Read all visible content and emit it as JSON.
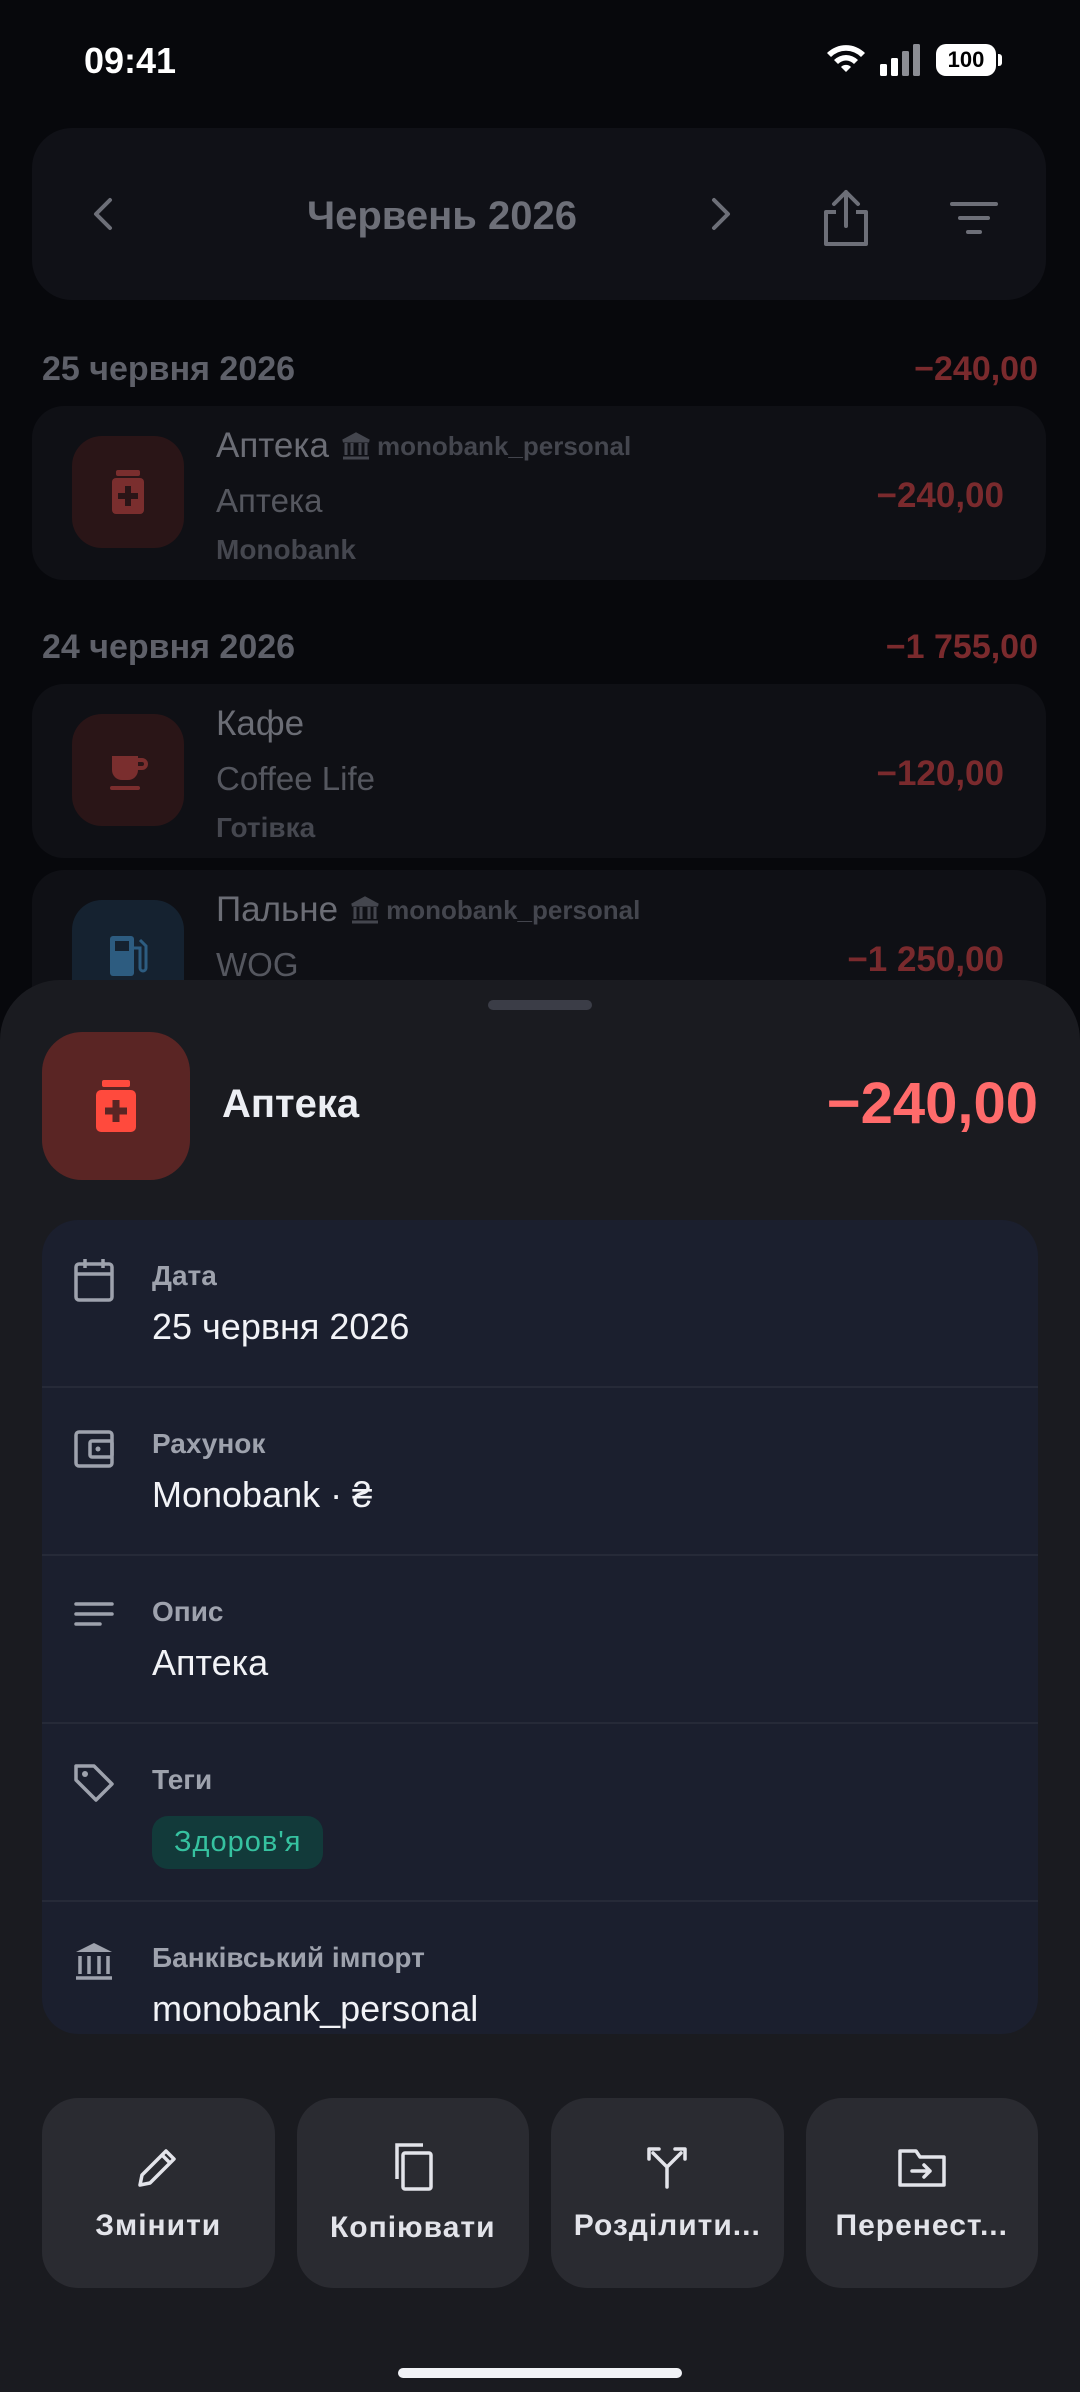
{
  "status": {
    "time": "09:41",
    "battery": "100"
  },
  "header": {
    "month": "Червень 2026"
  },
  "days": [
    {
      "date": "25 червня 2026",
      "total": "−240,00"
    },
    {
      "date": "24 червня 2026",
      "total": "−1 755,00"
    }
  ],
  "transactions": [
    {
      "category": "Аптека",
      "bank": "monobank_personal",
      "description": "Аптека",
      "account": "Monobank",
      "amount": "−240,00",
      "icon": "pharmacy-icon"
    },
    {
      "category": "Кафе",
      "bank": "",
      "description": "Coffee Life",
      "account": "Готівка",
      "amount": "−120,00",
      "icon": "coffee-icon"
    },
    {
      "category": "Пальне",
      "bank": "monobank_personal",
      "description": "WOG",
      "account": "",
      "amount": "−1 250,00",
      "icon": "fuel-icon"
    }
  ],
  "sheet": {
    "title": "Аптека",
    "amount": "−240,00",
    "fields": {
      "date": {
        "label": "Дата",
        "value": "25 червня 2026"
      },
      "account": {
        "label": "Рахунок",
        "value": "Monobank · ₴"
      },
      "description": {
        "label": "Опис",
        "value": "Аптека"
      },
      "tags": {
        "label": "Теги",
        "value": "Здоров'я"
      },
      "bank_import": {
        "label": "Банківський імпорт",
        "value": "monobank_personal"
      }
    },
    "actions": {
      "edit": "Змінити",
      "copy": "Копіювати",
      "split": "Розділити...",
      "move": "Перенест..."
    }
  },
  "colors": {
    "expense": "#ff6b6b",
    "tag_text": "#36c2a0",
    "tag_bg": "#123a3a",
    "card": "#1b1f2e",
    "sheet": "#1a1b20"
  }
}
